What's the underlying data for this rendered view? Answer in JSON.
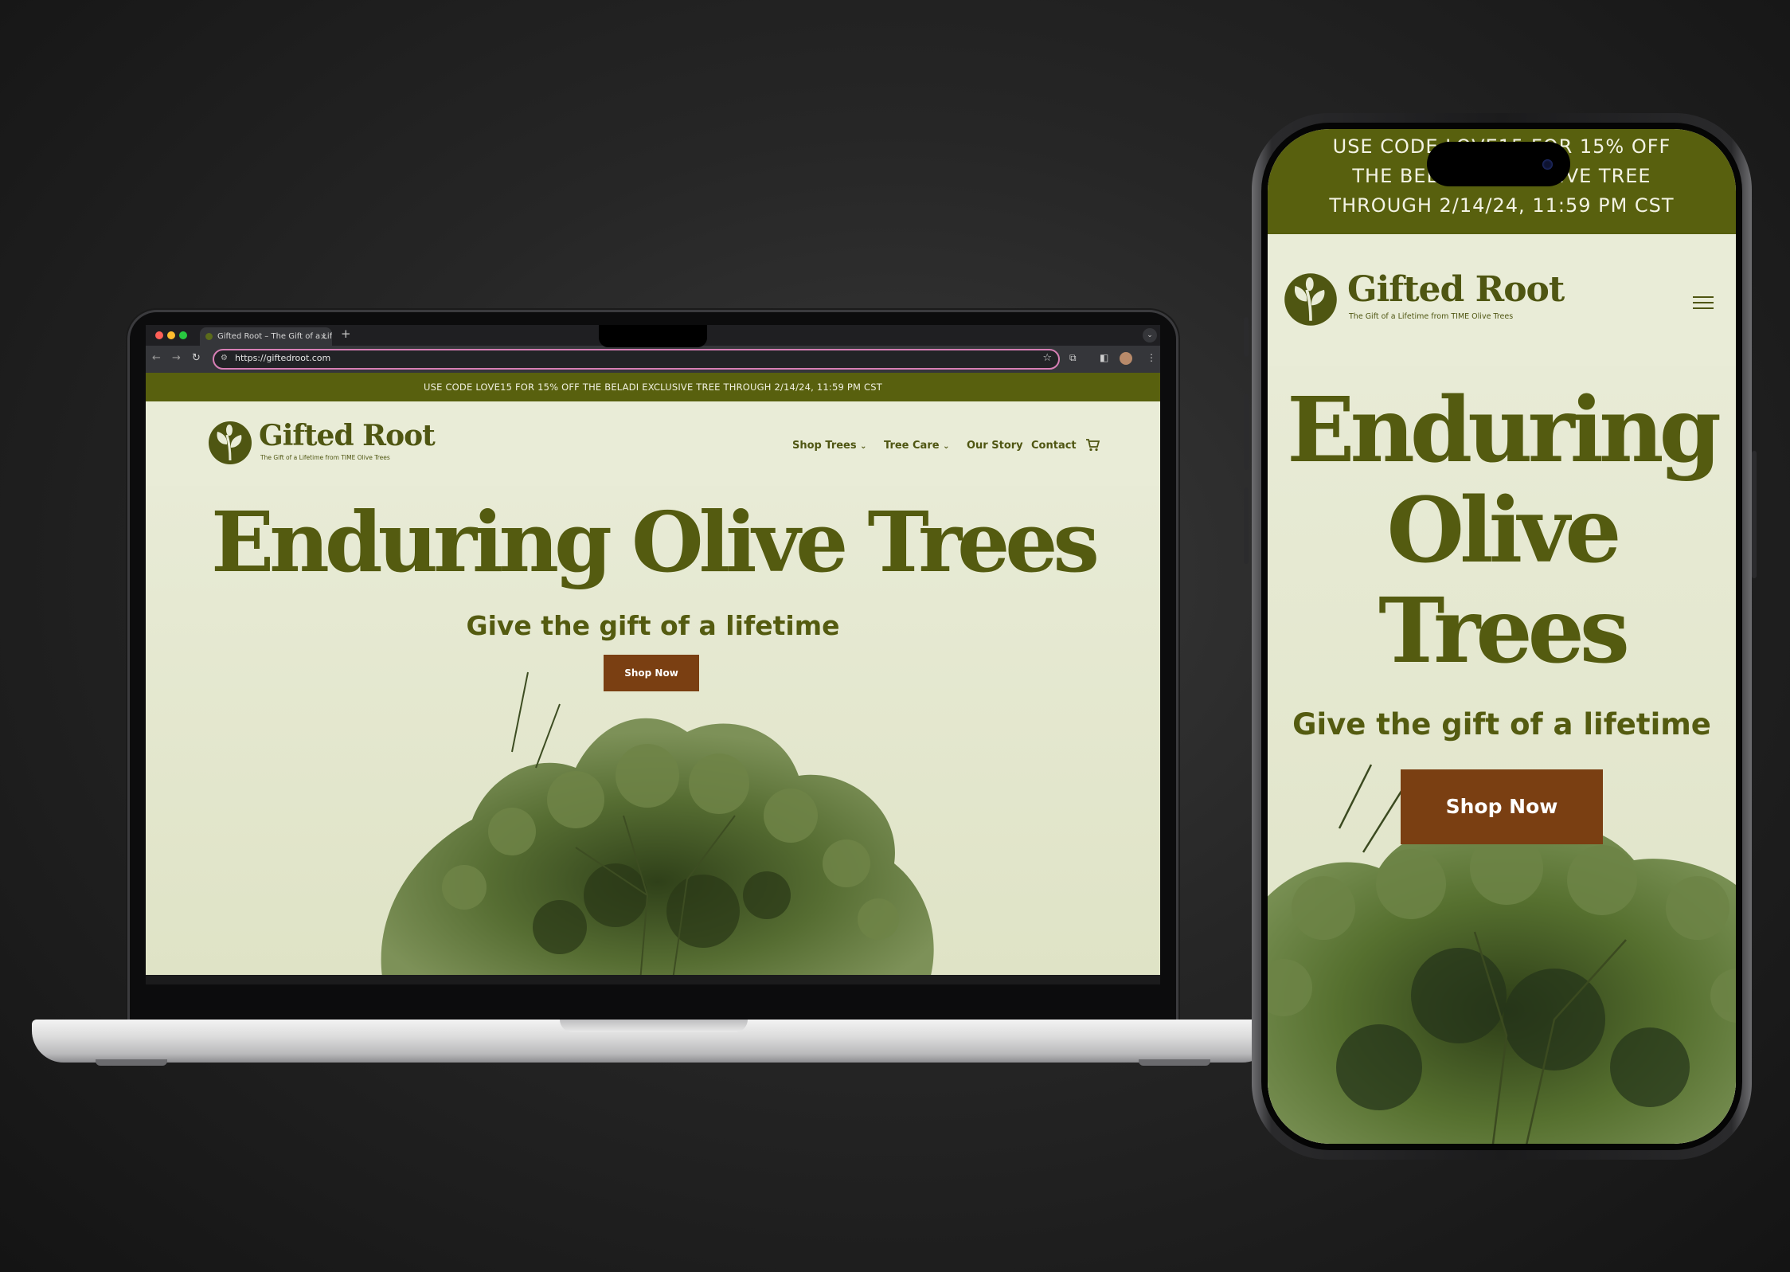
{
  "browser": {
    "tab_title": "Gifted Root – The Gift of a Lif",
    "tab_close": "×",
    "new_tab": "+",
    "url": "https://giftedroot.com"
  },
  "site": {
    "promo_desktop": "USE CODE LOVE15 FOR 15% OFF THE BELADI EXCLUSIVE TREE THROUGH 2/14/24, 11:59 PM CST",
    "promo_mobile_lines": [
      "USE CODE LOVE15 FOR 15% OFF",
      "THE BELADI EXCLUSIVE TREE",
      "THROUGH 2/14/24, 11:59 PM CST"
    ],
    "brand_name": "Gifted Root",
    "brand_tagline": "The Gift of a Lifetime from TIME Olive Trees",
    "nav": [
      {
        "label": "Shop Trees",
        "caret": "⌄"
      },
      {
        "label": "Tree Care",
        "caret": "⌄"
      },
      {
        "label": "Our Story",
        "caret": ""
      },
      {
        "label": "Contact",
        "caret": ""
      }
    ],
    "hero_title": "Enduring Olive Trees",
    "hero_title_mobile": [
      "Enduring",
      "Olive",
      "Trees"
    ],
    "hero_subtitle": "Give the gift of a lifetime",
    "cta_label": "Shop Now"
  },
  "icons": [
    "logo-leaf-icon",
    "cart-icon",
    "hamburger-menu-icon",
    "star-icon",
    "back-icon",
    "forward-icon",
    "reload-icon"
  ],
  "colors": {
    "olive": "#58600e",
    "text_olive": "#545b10",
    "cta_brown": "#7a3f12",
    "cream": "#e8ebd6"
  }
}
